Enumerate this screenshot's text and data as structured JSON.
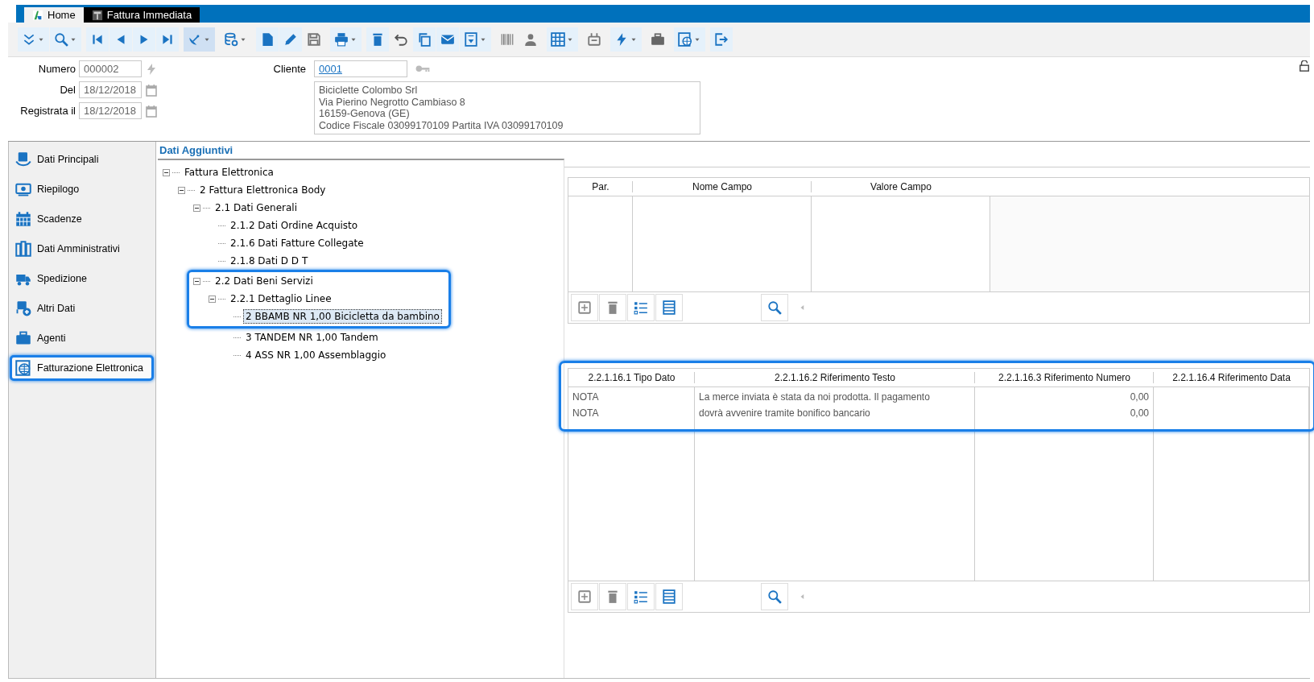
{
  "tabs": [
    {
      "label": "Home",
      "selected": false
    },
    {
      "label": "Fattura Immediata",
      "selected": true
    }
  ],
  "header": {
    "fields": [
      {
        "label": "Numero",
        "value": "000002",
        "kind": "code"
      },
      {
        "label": "Del",
        "value": "18/12/2018",
        "kind": "date"
      },
      {
        "label": "Registrata il",
        "value": "18/12/2018",
        "kind": "date"
      }
    ],
    "cliente": {
      "label": "Cliente",
      "value": "0001",
      "address": [
        "Biciclette Colombo Srl",
        "Via Pierino Negrotto Cambiaso 8",
        "16159-Genova (GE)",
        "Codice Fiscale 03099170109 Partita IVA 03099170109"
      ]
    }
  },
  "sidebar": {
    "items": [
      {
        "label": "Dati Principali"
      },
      {
        "label": "Riepilogo"
      },
      {
        "label": "Scadenze"
      },
      {
        "label": "Dati Amministrativi"
      },
      {
        "label": "Spedizione"
      },
      {
        "label": "Altri Dati"
      },
      {
        "label": "Agenti"
      },
      {
        "label": "Fatturazione Elettronica",
        "highlighted": true
      }
    ]
  },
  "section_title": "Dati Aggiuntivi",
  "tree": [
    {
      "label": "Fattura Elettronica",
      "expanded": true,
      "selected": false,
      "children": [
        {
          "label": "2 Fattura Elettronica Body",
          "expanded": true,
          "selected": false,
          "children": [
            {
              "label": "2.1 Dati Generali",
              "expanded": true,
              "selected": false,
              "children": [
                {
                  "label": "2.1.2 Dati Ordine Acquisto",
                  "selected": false
                },
                {
                  "label": "2.1.6 Dati Fatture Collegate",
                  "selected": false
                },
                {
                  "label": "2.1.8 Dati D D T",
                  "selected": false
                }
              ]
            },
            {
              "label": "2.2 Dati Beni Servizi",
              "expanded": true,
              "selected": false,
              "highlighted": true,
              "children": [
                {
                  "label": "2.2.1 Dettaglio Linee",
                  "expanded": true,
                  "selected": false,
                  "highlighted": true,
                  "children": [
                    {
                      "label": "2 BBAMB NR 1,00 Bicicletta da bambino",
                      "selected": true,
                      "highlighted": true
                    },
                    {
                      "label": "3 TANDEM NR 1,00 Tandem",
                      "selected": false
                    },
                    {
                      "label": "4 ASS NR 1,00 Assemblaggio",
                      "selected": false
                    }
                  ]
                }
              ]
            }
          ]
        }
      ]
    }
  ],
  "parameters_grid": {
    "columns": [
      "Par.",
      "Nome Campo",
      "Valore Campo"
    ]
  },
  "references_grid": {
    "highlighted": true,
    "columns": [
      "2.2.1.16.1 Tipo Dato",
      "2.2.1.16.2 Riferimento Testo",
      "2.2.1.16.3 Riferimento Numero",
      "2.2.1.16.4 Riferimento Data"
    ],
    "rows": [
      [
        "NOTA",
        "La merce inviata è stata da noi prodotta. Il pagamento",
        "0,00"
      ],
      [
        "NOTA",
        "dovrà avvenire tramite bonifico bancario",
        "0,00"
      ]
    ]
  }
}
